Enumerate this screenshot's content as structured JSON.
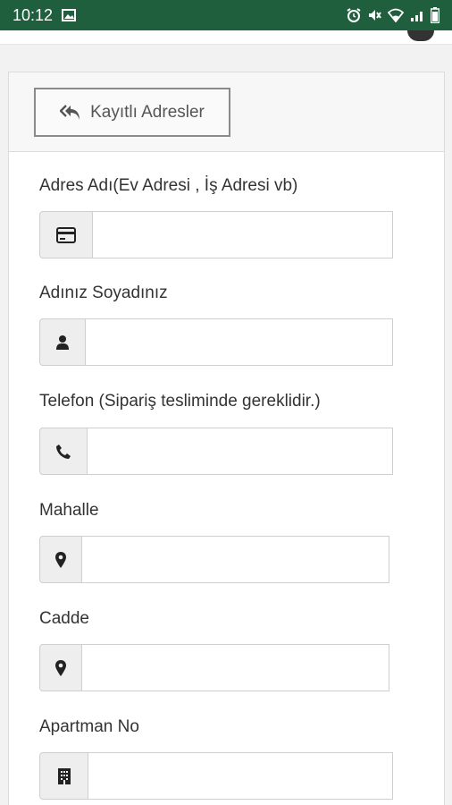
{
  "status_bar": {
    "time": "10:12",
    "icons": [
      "image-icon",
      "alarm-icon",
      "mute-icon",
      "wifi-icon",
      "signal-icon",
      "battery-icon"
    ]
  },
  "header": {
    "saved_addresses_label": "Kayıtlı Adresler",
    "saved_addresses_icon": "reply-all-icon"
  },
  "form": {
    "fields": [
      {
        "label": "Adres Adı(Ev Adresi , İş Adresi vb)",
        "icon": "credit-card-icon",
        "value": "",
        "placeholder": ""
      },
      {
        "label": "Adınız Soyadınız",
        "icon": "user-icon",
        "value": "",
        "placeholder": ""
      },
      {
        "label": "Telefon (Sipariş tesliminde gereklidir.)",
        "icon": "phone-icon",
        "value": "",
        "placeholder": ""
      },
      {
        "label": "Mahalle",
        "icon": "map-marker-icon",
        "value": "",
        "placeholder": ""
      },
      {
        "label": "Cadde",
        "icon": "map-marker-icon",
        "value": "",
        "placeholder": ""
      },
      {
        "label": "Apartman No",
        "icon": "building-icon",
        "value": "",
        "placeholder": ""
      }
    ]
  },
  "colors": {
    "status_bar_bg": "#1f5f3d",
    "addon_bg": "#eeeeee",
    "border": "#cfcfcf",
    "text": "#333333"
  }
}
